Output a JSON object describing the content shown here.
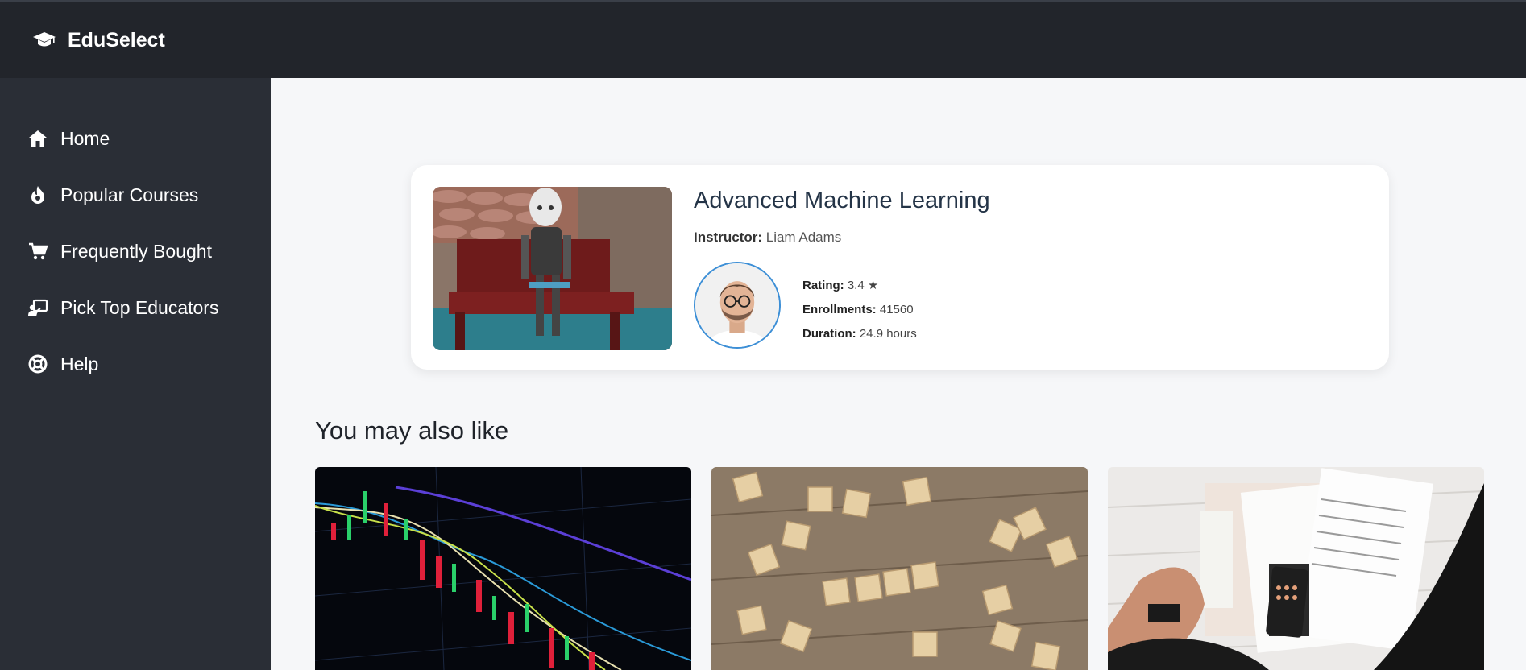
{
  "app": {
    "brand": "EduSelect"
  },
  "sidebar": {
    "items": [
      {
        "label": "Home",
        "icon": "home-icon"
      },
      {
        "label": "Popular Courses",
        "icon": "fire-icon"
      },
      {
        "label": "Frequently Bought",
        "icon": "cart-icon"
      },
      {
        "label": "Pick Top Educators",
        "icon": "educator-icon"
      },
      {
        "label": "Help",
        "icon": "lifebuoy-icon"
      }
    ]
  },
  "featured": {
    "title": "Advanced Machine Learning",
    "instructor_label": "Instructor:",
    "instructor": "Liam Adams",
    "rating_label": "Rating:",
    "rating": "3.4 ★",
    "enrollments_label": "Enrollments:",
    "enrollments": "41560",
    "duration_label": "Duration:",
    "duration": "24.9 hours"
  },
  "recommendations": {
    "title": "You may also like"
  },
  "colors": {
    "topbar": "#22252b",
    "sidebar": "#2a2e36",
    "accent": "#3d8fd6"
  }
}
